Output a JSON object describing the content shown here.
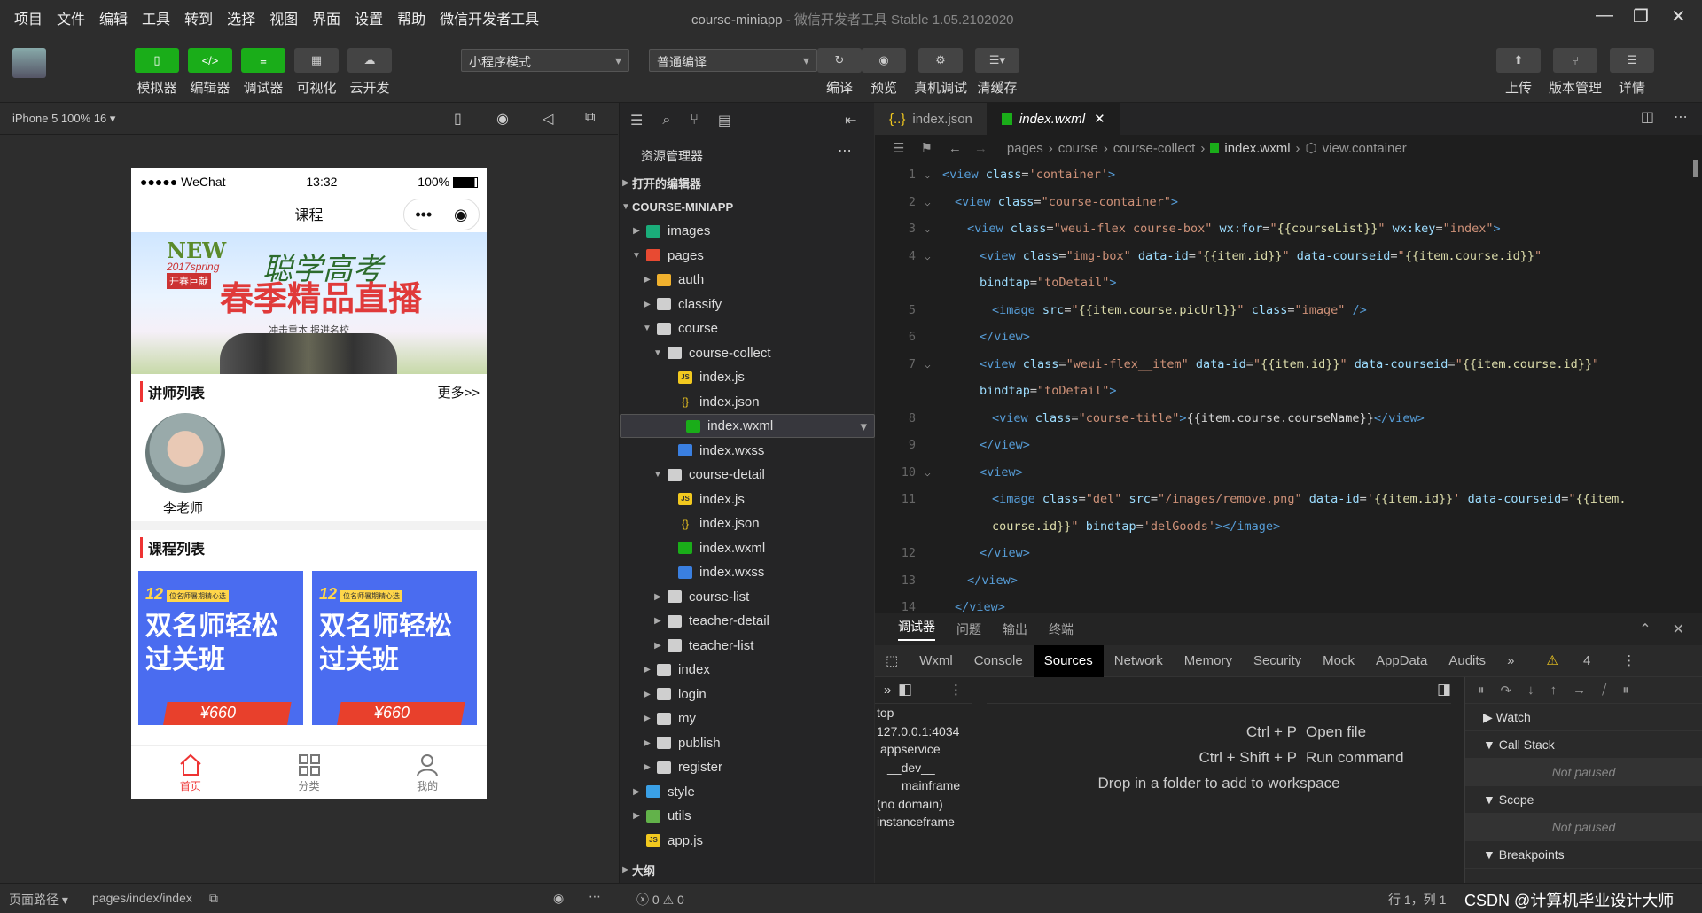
{
  "menu": [
    "项目",
    "文件",
    "编辑",
    "工具",
    "转到",
    "选择",
    "视图",
    "界面",
    "设置",
    "帮助",
    "微信开发者工具"
  ],
  "window": {
    "title": "course-miniapp",
    "subtitle": "- 微信开发者工具 Stable 1.05.2102020"
  },
  "toolbar": {
    "left_buttons": [
      "模拟器",
      "编辑器",
      "调试器",
      "可视化",
      "云开发"
    ],
    "mode_select": "小程序模式",
    "compile_select": "普通编译",
    "mid_buttons": [
      "编译",
      "预览",
      "真机调试",
      "清缓存"
    ],
    "right_buttons": [
      "上传",
      "版本管理",
      "详情"
    ]
  },
  "device": {
    "label": "iPhone 5 100% 16"
  },
  "phone": {
    "carrier": "●●●●● WeChat",
    "time": "13:32",
    "battery": "100%",
    "nav_title": "课程",
    "banner": {
      "new": "NEW",
      "spring": "2017spring",
      "kaichun": "开春巨献",
      "brand": "聪学高考",
      "headline": "春季精品直播",
      "sub": "冲击重本 报进名校"
    },
    "teachers_header": "讲师列表",
    "more": "更多>>",
    "teacher_name": "李老师",
    "courses_header": "课程列表",
    "course_cards": [
      {
        "num": "12",
        "tag": "位名师暑期精心选",
        "title": "双名师轻松过关班",
        "price": "¥660"
      },
      {
        "num": "12",
        "tag": "位名师暑期精心选",
        "title": "双名师轻松过关班",
        "price": "¥660"
      }
    ],
    "tabs": [
      "首页",
      "分类",
      "我的"
    ]
  },
  "explorer": {
    "title": "资源管理器",
    "open_editors": "打开的编辑器",
    "project": "COURSE-MINIAPP",
    "tree": [
      {
        "name": "images",
        "type": "folder-img",
        "depth": 1,
        "open": false
      },
      {
        "name": "pages",
        "type": "folder-pg",
        "depth": 1,
        "open": true
      },
      {
        "name": "auth",
        "type": "folder-auth",
        "depth": 2,
        "open": false
      },
      {
        "name": "classify",
        "type": "folder",
        "depth": 2,
        "open": false
      },
      {
        "name": "course",
        "type": "folder",
        "depth": 2,
        "open": true
      },
      {
        "name": "course-collect",
        "type": "folder",
        "depth": 3,
        "open": true
      },
      {
        "name": "index.js",
        "type": "js",
        "depth": 4
      },
      {
        "name": "index.json",
        "type": "json",
        "depth": 4
      },
      {
        "name": "index.wxml",
        "type": "wxml",
        "depth": 4,
        "selected": true
      },
      {
        "name": "index.wxss",
        "type": "wxss",
        "depth": 4
      },
      {
        "name": "course-detail",
        "type": "folder",
        "depth": 3,
        "open": true
      },
      {
        "name": "index.js",
        "type": "js",
        "depth": 4
      },
      {
        "name": "index.json",
        "type": "json",
        "depth": 4
      },
      {
        "name": "index.wxml",
        "type": "wxml",
        "depth": 4
      },
      {
        "name": "index.wxss",
        "type": "wxss",
        "depth": 4
      },
      {
        "name": "course-list",
        "type": "folder",
        "depth": 3,
        "open": false
      },
      {
        "name": "teacher-detail",
        "type": "folder",
        "depth": 3,
        "open": false
      },
      {
        "name": "teacher-list",
        "type": "folder",
        "depth": 3,
        "open": false
      },
      {
        "name": "index",
        "type": "folder",
        "depth": 2,
        "open": false
      },
      {
        "name": "login",
        "type": "folder",
        "depth": 2,
        "open": false
      },
      {
        "name": "my",
        "type": "folder",
        "depth": 2,
        "open": false
      },
      {
        "name": "publish",
        "type": "folder",
        "depth": 2,
        "open": false
      },
      {
        "name": "register",
        "type": "folder",
        "depth": 2,
        "open": false
      },
      {
        "name": "style",
        "type": "folder-st",
        "depth": 1,
        "open": false
      },
      {
        "name": "utils",
        "type": "folder-ut",
        "depth": 1,
        "open": false
      },
      {
        "name": "app.js",
        "type": "js",
        "depth": 1
      }
    ],
    "outline": "大纲"
  },
  "editor": {
    "tabs": [
      "index.json",
      "index.wxml"
    ],
    "breadcrumb": [
      "pages",
      "course",
      "course-collect",
      "index.wxml",
      "view.container"
    ],
    "lines": [
      {
        "n": "1",
        "fold": true,
        "indent": 0,
        "html": "<span class='tg'>&lt;view</span> <span class='at'>class</span>=<span class='st'>'container'</span><span class='tg'>&gt;</span>"
      },
      {
        "n": "2",
        "fold": true,
        "indent": 1,
        "html": "<span class='tg'>&lt;view</span> <span class='at'>class</span>=<span class='st'>\"course-container\"</span><span class='tg'>&gt;</span>"
      },
      {
        "n": "3",
        "fold": true,
        "indent": 2,
        "html": "<span class='tg'>&lt;view</span> <span class='at'>class</span>=<span class='st'>\"weui-flex course-box\"</span> <span class='at'>wx:for</span>=<span class='st'>\"</span><span class='ex'>{{courseList}}</span><span class='st'>\"</span> <span class='at'>wx:key</span>=<span class='st'>\"index\"</span><span class='tg'>&gt;</span>"
      },
      {
        "n": "4",
        "fold": true,
        "indent": 3,
        "html": "<span class='tg'>&lt;view</span> <span class='at'>class</span>=<span class='st'>\"img-box\"</span> <span class='at'>data-id</span>=<span class='st'>\"</span><span class='ex'>{{item.id}}</span><span class='st'>\"</span> <span class='at'>data-courseid</span>=<span class='st'>\"</span><span class='ex'>{{item.course.id}}</span><span class='st'>\"</span>"
      },
      {
        "n": "",
        "fold": false,
        "indent": 3,
        "html": "<span class='at'>bindtap</span>=<span class='st'>\"toDetail\"</span><span class='tg'>&gt;</span>"
      },
      {
        "n": "5",
        "fold": false,
        "indent": 4,
        "html": "<span class='tg'>&lt;image</span> <span class='at'>src</span>=<span class='st'>\"</span><span class='ex'>{{item.course.picUrl}}</span><span class='st'>\"</span> <span class='at'>class</span>=<span class='st'>\"image\"</span> <span class='tg'>/&gt;</span>"
      },
      {
        "n": "6",
        "fold": false,
        "indent": 3,
        "html": "<span class='tg'>&lt;/view&gt;</span>"
      },
      {
        "n": "7",
        "fold": true,
        "indent": 3,
        "html": "<span class='tg'>&lt;view</span> <span class='at'>class</span>=<span class='st'>\"weui-flex__item\"</span> <span class='at'>data-id</span>=<span class='st'>\"</span><span class='ex'>{{item.id}}</span><span class='st'>\"</span> <span class='at'>data-courseid</span>=<span class='st'>\"</span><span class='ex'>{{item.course.id}}</span><span class='st'>\"</span>"
      },
      {
        "n": "",
        "fold": false,
        "indent": 3,
        "html": "<span class='at'>bindtap</span>=<span class='st'>\"toDetail\"</span><span class='tg'>&gt;</span>"
      },
      {
        "n": "8",
        "fold": false,
        "indent": 4,
        "html": "<span class='tg'>&lt;view</span> <span class='at'>class</span>=<span class='st'>\"course-title\"</span><span class='tg'>&gt;</span><span class='tx'>{{item.course.courseName}}</span><span class='tg'>&lt;/view&gt;</span>"
      },
      {
        "n": "9",
        "fold": false,
        "indent": 3,
        "html": "<span class='tg'>&lt;/view&gt;</span>"
      },
      {
        "n": "10",
        "fold": true,
        "indent": 3,
        "html": "<span class='tg'>&lt;view&gt;</span>"
      },
      {
        "n": "11",
        "fold": false,
        "indent": 4,
        "html": "<span class='tg'>&lt;image</span> <span class='at'>class</span>=<span class='st'>\"del\"</span> <span class='at'>src</span>=<span class='st'>\"/images/remove.png\"</span> <span class='at'>data-id</span>=<span class='st'>'</span><span class='ex'>{{item.id}}</span><span class='st'>'</span> <span class='at'>data-courseid</span>=<span class='st'>\"</span><span class='ex'>{{item.</span>"
      },
      {
        "n": "",
        "fold": false,
        "indent": 4,
        "html": "<span class='ex'>course.id}}</span><span class='st'>\"</span> <span class='at'>bindtap</span>=<span class='st'>'delGoods'</span><span class='tg'>&gt;&lt;/image&gt;</span>"
      },
      {
        "n": "12",
        "fold": false,
        "indent": 3,
        "html": "<span class='tg'>&lt;/view&gt;</span>"
      },
      {
        "n": "13",
        "fold": false,
        "indent": 2,
        "html": "<span class='tg'>&lt;/view&gt;</span>"
      },
      {
        "n": "14",
        "fold": false,
        "indent": 1,
        "html": "<span class='tg'>&lt;/view&gt;</span>"
      }
    ]
  },
  "debugger": {
    "top_tabs": [
      "调试器",
      "问题",
      "输出",
      "终端"
    ],
    "tabs": [
      "Wxml",
      "Console",
      "Sources",
      "Network",
      "Memory",
      "Security",
      "Mock",
      "AppData",
      "Audits"
    ],
    "active_tab": "Sources",
    "warnings": "4",
    "left_items": [
      "top",
      "127.0.0.1:4034",
      "appservice",
      "__dev__",
      "mainframe",
      "(no domain)",
      "instanceframe"
    ],
    "shortcuts": [
      {
        "keys": "Ctrl + P",
        "action": "Open file"
      },
      {
        "keys": "Ctrl + Shift + P",
        "action": "Run command"
      }
    ],
    "drop_hint": "Drop in a folder to add to workspace",
    "right_sections": [
      {
        "title": "Watch",
        "collapsed": true
      },
      {
        "title": "Call Stack",
        "collapsed": false,
        "body": "Not paused"
      },
      {
        "title": "Scope",
        "collapsed": false,
        "body": "Not paused"
      },
      {
        "title": "Breakpoints",
        "collapsed": false
      }
    ]
  },
  "statusbar": {
    "left_label": "页面路径",
    "path": "pages/index/index",
    "errors": "0",
    "warnings": "0",
    "cursor": "行 1，列 1",
    "watermark": "CSDN @计算机毕业设计大师"
  }
}
